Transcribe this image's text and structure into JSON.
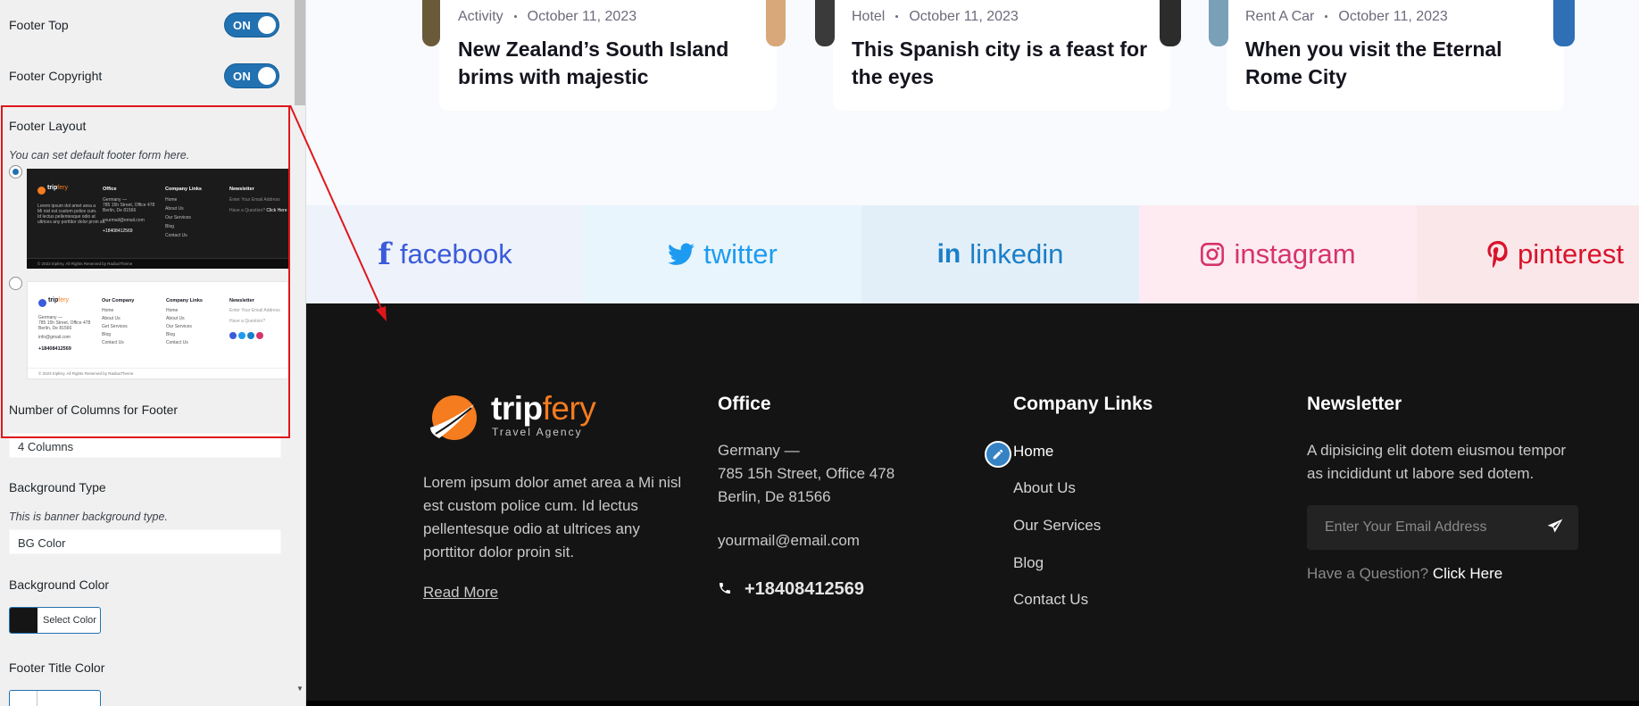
{
  "panel": {
    "footer_top": {
      "label": "Footer Top",
      "toggle": "ON"
    },
    "footer_copyright": {
      "label": "Footer Copyright",
      "toggle": "ON"
    },
    "footer_layout": {
      "label": "Footer Layout",
      "description": "You can set default footer form here.",
      "selected": "layout-1"
    },
    "layout1_thumb": {
      "brand_a": "trip",
      "brand_b": "fery",
      "lorem": [
        "Lorem ipsum dol amet area a",
        "Mi nisl est custom police cum.",
        "Id lectus pellentesque odio at",
        "ultrices any porttitor dolor proin sit."
      ],
      "office_title": "Office",
      "office_lines": [
        "Germany —",
        "785 15h Street, Office 478",
        "Berlin, De 81566"
      ],
      "email": "yourmail@email.com",
      "phone": "+18408412569",
      "links_title": "Company Links",
      "links": [
        "Home",
        "About Us",
        "Our Services",
        "Blog",
        "Contact Us"
      ],
      "news_title": "Newsletter",
      "news_input": "Enter Your Email Address",
      "news_help": "Have a Question?",
      "news_click": "Click Here",
      "copyright": "© 2023 tripfery. All Rights Reserved by RadiusTheme"
    },
    "layout2_thumb": {
      "brand_a": "trip",
      "brand_b": "fery",
      "address_lines": [
        "Germany —",
        "785 15h Street, Office 478",
        "Berlin, De 81566"
      ],
      "email": "info@gmail.com",
      "phone": "+18408412569",
      "our_company_title": "Our Company",
      "our_company_links": [
        "Home",
        "About Us",
        "Get Services",
        "Blog",
        "Contact Us"
      ],
      "links_title": "Company Links",
      "links": [
        "Home",
        "About Us",
        "Our Services",
        "Blog",
        "Contact Us"
      ],
      "news_title": "Newsletter",
      "news_input": "Enter Your Email Address",
      "news_help": "Have a Question?",
      "copyright": "© 2023 tripfery. All Rights Reserved by RadiusTheme"
    },
    "columns": {
      "label": "Number of Columns for Footer",
      "value": "4 Columns"
    },
    "bg_type": {
      "label": "Background Type",
      "description": "This is banner background type.",
      "value": "BG Color"
    },
    "bg_color": {
      "label": "Background Color",
      "button": "Select Color",
      "swatch": "#151515"
    },
    "title_color": {
      "label": "Footer Title Color"
    }
  },
  "cards": [
    {
      "category": "Activity",
      "date": "October 11, 2023",
      "title": "New Zealand’s South Island brims with majestic"
    },
    {
      "category": "Hotel",
      "date": "October 11, 2023",
      "title": "This Spanish city is a feast for the eyes"
    },
    {
      "category": "Rent A Car",
      "date": "October 11, 2023",
      "title": "When you visit the Eternal Rome City"
    }
  ],
  "social": [
    {
      "icon": "facebook-icon",
      "glyph": "f",
      "label": "facebook",
      "color": "#3b5bdb",
      "bg": "#eef2fb"
    },
    {
      "icon": "twitter-icon",
      "glyph": "",
      "label": "twitter",
      "color": "#1d9bf0",
      "bg": "#e9f5fc"
    },
    {
      "icon": "linkedin-icon",
      "glyph": "in",
      "label": "linkedin",
      "color": "#1a7fc9",
      "bg": "#e3eff8"
    },
    {
      "icon": "instagram-icon",
      "glyph": "",
      "label": "instagram",
      "color": "#d6336c",
      "bg": "#fdebf1"
    },
    {
      "icon": "pinterest-icon",
      "glyph": "P",
      "label": "pinterest",
      "color": "#d9132b",
      "bg": "#f9e7e9"
    }
  ],
  "footer": {
    "brand_a": "trip",
    "brand_b": "fery",
    "tagline": "Travel Agency",
    "about": "Lorem ipsum dolor amet area a Mi nisl est custom police cum. Id lectus pellentesque odio at ultrices any porttitor dolor proin sit.",
    "read_more": "Read More",
    "office": {
      "title": "Office",
      "line1": "Germany —",
      "line2": "785 15h Street, Office 478",
      "line3": "Berlin, De 81566",
      "email": "yourmail@email.com",
      "phone": "+18408412569"
    },
    "company": {
      "title": "Company Links",
      "links": [
        "Home",
        "About Us",
        "Our Services",
        "Blog",
        "Contact Us"
      ]
    },
    "newsletter": {
      "title": "Newsletter",
      "text": "A dipisicing elit dotem eiusmou tempor as incididunt ut labore sed dotem.",
      "placeholder": "Enter Your Email Address",
      "question": "Have a Question?",
      "click": "Click Here"
    }
  }
}
